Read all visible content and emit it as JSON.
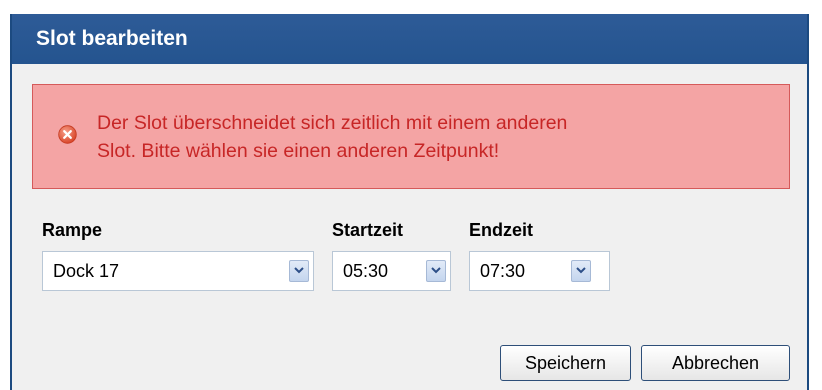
{
  "dialog": {
    "title": "Slot bearbeiten"
  },
  "error": {
    "icon": "error-icon",
    "line1": "Der Slot überschneidet sich zeitlich mit einem anderen",
    "line2": "Slot. Bitte wählen sie einen anderen Zeitpunkt!",
    "colors": {
      "background": "#f4a4a4",
      "border": "#d55a5a",
      "text": "#c72626"
    }
  },
  "form": {
    "rampe": {
      "label": "Rampe",
      "value": "Dock 17"
    },
    "startzeit": {
      "label": "Startzeit",
      "value": "05:30"
    },
    "endzeit": {
      "label": "Endzeit",
      "value": "07:30"
    }
  },
  "buttons": {
    "save_label": "Speichern",
    "cancel_label": "Abbrechen"
  },
  "colors": {
    "titlebar": "#24548f",
    "dialog_bg": "#f0f0f0"
  }
}
